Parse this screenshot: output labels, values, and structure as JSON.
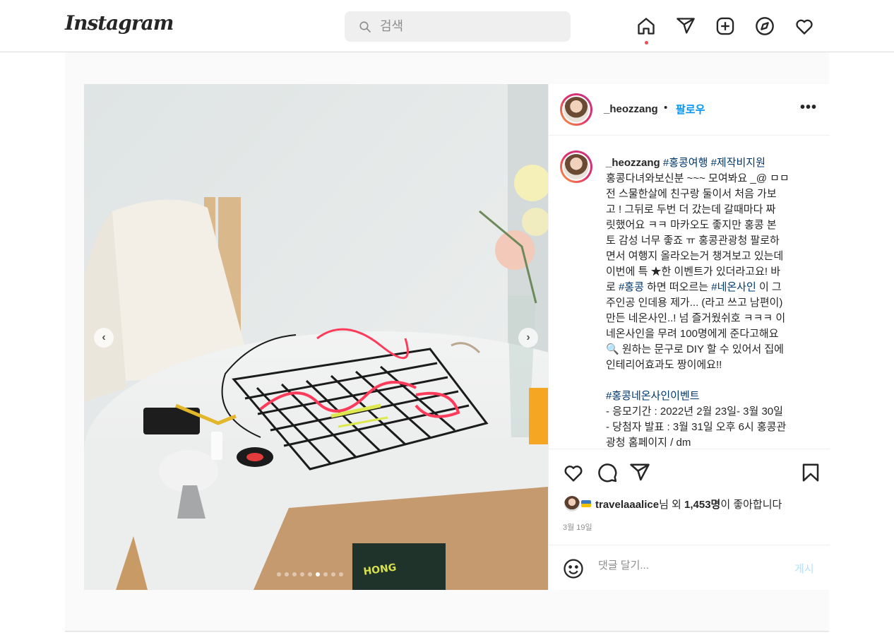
{
  "app": {
    "logo": "Instagram"
  },
  "search": {
    "placeholder": "검색"
  },
  "nav": {
    "icons": [
      "home-icon",
      "direct-icon",
      "new-post-icon",
      "explore-icon",
      "activity-heart-icon"
    ],
    "active": "home-icon"
  },
  "post": {
    "username": "_heozzang",
    "separator": "•",
    "follow_label": "팔로우",
    "more_label": "•••",
    "carousel": {
      "slide_count": 9,
      "active_index": 5
    },
    "caption": {
      "username": "_heozzang",
      "tags_line": "#홍콩여행 #제작비지원",
      "l1": "홍콩다녀와보신분 ~~~ 모여봐요 _@ ㅁㅁ\n전 스물한살에 친구랑 둘이서 처음 가보\n고 ! 그뒤로 두번 더 갔는데 갈때마다 짜\n릿했어요 ㅋㅋ 마카오도 좋지만 홍콩 본\n토 감성 너무 좋죠 ㅠ 홍콩관광청 팔로하\n면서 여행지 올라오는거 챙겨보고 있는데\n이번에 특 ★한 이벤트가 있더라고요! 바\n로 ",
      "tag1": "#홍콩",
      "l2": " 하면 떠오르는 ",
      "tag2": "#네온사인",
      "l3": " 이 그\n주인공 인데용 제가... (라고 쓰고 남편이)\n만든 네온사인..! 넘 즐거웠쉬호 ㅋㅋㅋ 이\n네온사인을 무려 100명에게 준다고해요\n🔍 원하는 문구로 DIY 할 수 있어서 집에\n인테리어효과도 짱이에요!!\n\n",
      "tag3": "#홍콩네온사인이벤트",
      "l4": "\n- 응모기간 : 2022년 2월 23일- 3월 30일\n- 당첨자 발표 : 3월 31일 오후 6시 홍콩관\n광청 홈페이지 / dm"
    },
    "likes": {
      "user": "travelaaalice",
      "suffix_1": "님 외 ",
      "count": "1,453명",
      "suffix_2": "이 좋아합니다"
    },
    "date": "3월 19일",
    "comment": {
      "placeholder": "댓글 달기...",
      "post_label": "게시"
    }
  }
}
